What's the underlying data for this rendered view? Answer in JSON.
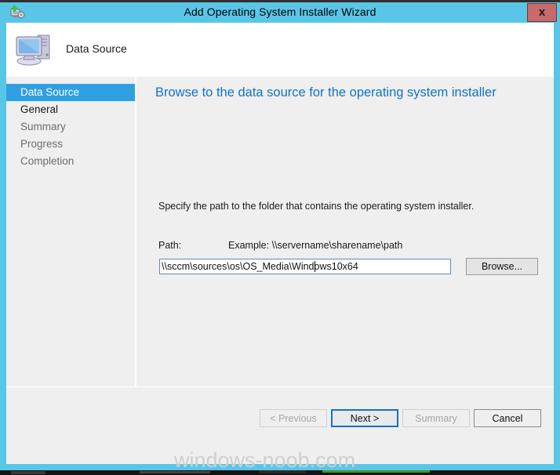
{
  "window": {
    "title": "Add Operating System Installer Wizard",
    "icon": "add-os-installer-icon",
    "close_label": "x",
    "accent_color": "#59c6e8"
  },
  "header": {
    "icon": "computer-icon",
    "page_name": "Data Source"
  },
  "navigation": {
    "items": [
      {
        "label": "Data Source",
        "state": "selected"
      },
      {
        "label": "General",
        "state": "visited"
      },
      {
        "label": "Summary",
        "state": "pending"
      },
      {
        "label": "Progress",
        "state": "pending"
      },
      {
        "label": "Completion",
        "state": "pending"
      }
    ],
    "selected_color": "#2f9fe3"
  },
  "content": {
    "heading": "Browse to the data source for the operating system installer",
    "heading_color": "#1273c6",
    "instruction": "Specify the path to the folder that contains the operating system installer.",
    "path_label": "Path:",
    "example_label": "Example: \\\\servername\\sharename\\path",
    "path_value": "\\\\sccm\\sources\\os\\OS_Media\\Windows10x64",
    "path_placeholder": "",
    "browse_label": "Browse..."
  },
  "footer": {
    "previous_label": "< Previous",
    "next_label": "Next >",
    "summary_label": "Summary",
    "cancel_label": "Cancel"
  },
  "watermark": {
    "text": "windows-noob.com"
  }
}
